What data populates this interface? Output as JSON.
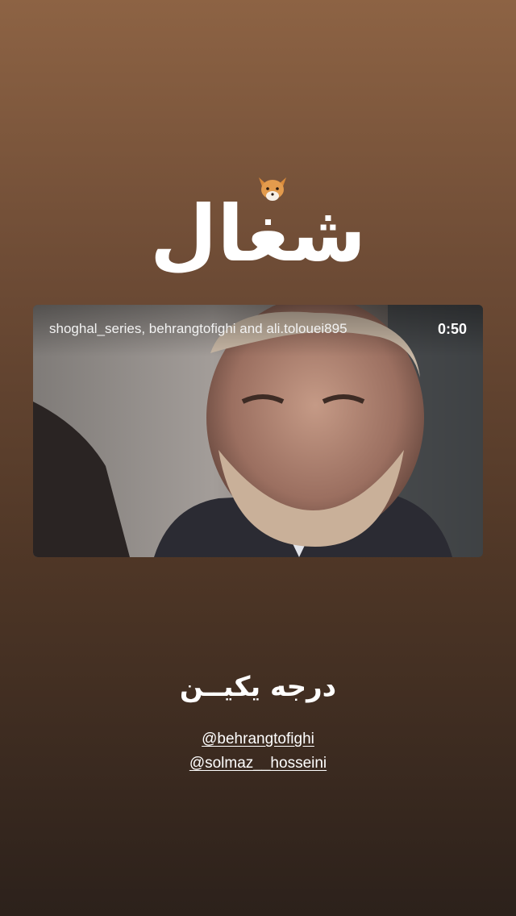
{
  "story": {
    "logo_text": "شغال",
    "logo_icon": "fox-icon",
    "video": {
      "credits": "shoghal_series, behrangtofighi and ali.tolouei895",
      "duration": "0:50"
    },
    "subtitle": "درجه یکیــن",
    "mentions": [
      "@behrangtofighi",
      "@solmaz__hosseini"
    ]
  },
  "colors": {
    "background_top": "#8d6344",
    "background_bottom": "#2c211b",
    "text": "#ffffff"
  }
}
